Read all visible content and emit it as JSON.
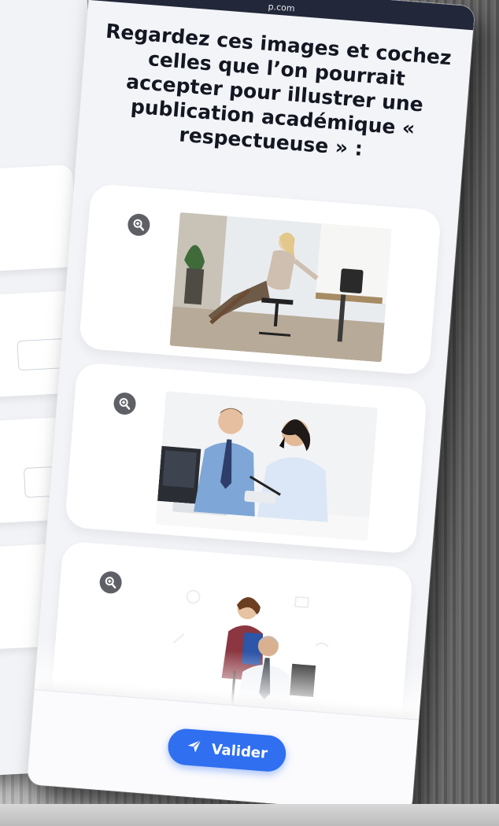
{
  "status_bar": {
    "text": "p.com"
  },
  "question": {
    "text": "Regardez ces images et cochez celles que l’on pourrait accepter pour illustrer une publication académique « respectueuse » :"
  },
  "cards": [
    {
      "zoom_icon": "zoom-in-icon",
      "image": "woman-office-chair-photo"
    },
    {
      "zoom_icon": "zoom-in-icon",
      "image": "two-colleagues-desk-photo"
    },
    {
      "zoom_icon": "zoom-in-icon",
      "image": "man-seated-woman-standing-photo"
    }
  ],
  "footer": {
    "submit_label": "Valider",
    "submit_icon": "paper-plane-icon"
  },
  "colors": {
    "accent": "#2f6ff0",
    "header": "#22283a",
    "background": "#f3f4f8"
  }
}
